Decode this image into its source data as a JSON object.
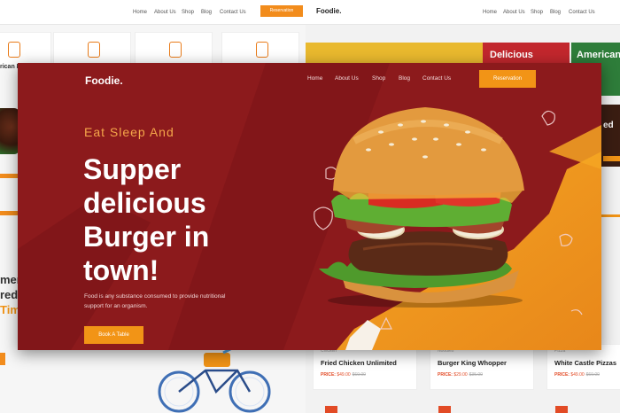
{
  "background_left": {
    "nav_links": [
      "Home",
      "About Us",
      "Shop",
      "Blog",
      "Contact Us"
    ],
    "reservation_label": "Reservation",
    "card_text_1": "rican Pi",
    "side_text_1": "ment",
    "side_text_2": "red C",
    "side_text_3": "Tim"
  },
  "background_right": {
    "logo": "Foodie.",
    "nav_links": [
      "Home",
      "About Us",
      "Shop",
      "Blog",
      "Contact Us"
    ],
    "promos": [
      "Delicious",
      "American"
    ],
    "promo_extra": "ed",
    "products": [
      {
        "category": "Chicken",
        "name": "Fried Chicken Unlimited",
        "price_label": "PRICE:",
        "price": "$49.00",
        "old_price": "$69.00"
      },
      {
        "category": "Noodles",
        "name": "Burger King Whopper",
        "price_label": "PRICE:",
        "price": "$29.00",
        "old_price": "$35.00"
      },
      {
        "category": "Pizza",
        "name": "White Castle Pizzas",
        "price_label": "PRICE:",
        "price": "$49.00",
        "old_price": "$69.00"
      }
    ]
  },
  "hero": {
    "logo": "Foodie.",
    "nav_links": [
      "Home",
      "About Us",
      "Shop",
      "Blog",
      "Contact Us"
    ],
    "reservation_label": "Reservation",
    "tagline": "Eat Sleep And",
    "headline_lines": [
      "Supper",
      "delicious",
      "Burger in",
      "town!"
    ],
    "description_lines": [
      "Food is any substance consumed to provide nutritional",
      "support for an organism."
    ],
    "book_label": "Book A Table"
  },
  "colors": {
    "hero_bg": "#8c1a1c",
    "accent_orange": "#f29416",
    "tagline": "#f4a64a"
  }
}
